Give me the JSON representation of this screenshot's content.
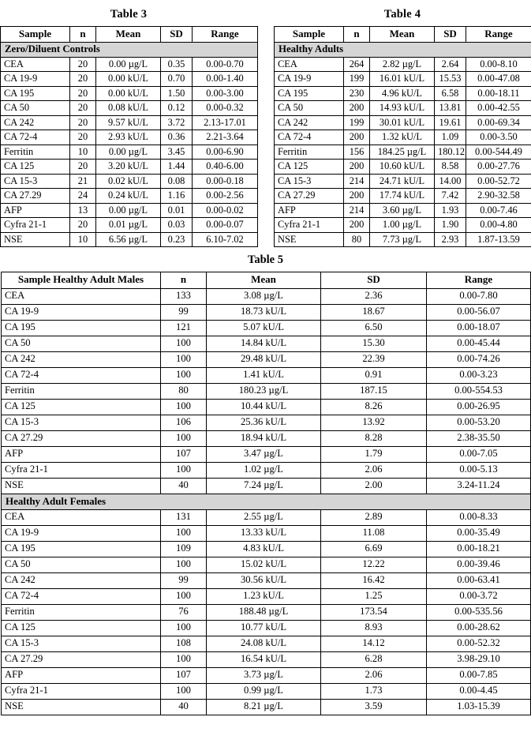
{
  "document": {
    "columns_header": [
      "Sample",
      "n",
      "Mean",
      "SD",
      "Range"
    ]
  },
  "table3": {
    "title": "Table 3",
    "headers": {
      "sample": "Sample",
      "n": "n",
      "mean": "Mean",
      "sd": "SD",
      "range": "Range"
    },
    "section_label": "Zero/Diluent Controls",
    "rows": [
      {
        "sample": "CEA",
        "n": "20",
        "mean": "0.00 µg/L",
        "sd": "0.35",
        "range": "0.00-0.70"
      },
      {
        "sample": "CA 19-9",
        "n": "20",
        "mean": "0.00 kU/L",
        "sd": "0.70",
        "range": "0.00-1.40"
      },
      {
        "sample": "CA 195",
        "n": "20",
        "mean": "0.00 kU/L",
        "sd": "1.50",
        "range": "0.00-3.00"
      },
      {
        "sample": "CA 50",
        "n": "20",
        "mean": "0.08 kU/L",
        "sd": "0.12",
        "range": "0.00-0.32"
      },
      {
        "sample": "CA 242",
        "n": "20",
        "mean": "9.57 kU/L",
        "sd": "3.72",
        "range": "2.13-17.01"
      },
      {
        "sample": "CA 72-4",
        "n": "20",
        "mean": "2.93 kU/L",
        "sd": "0.36",
        "range": "2.21-3.64"
      },
      {
        "sample": "Ferritin",
        "n": "10",
        "mean": "0.00 µg/L",
        "sd": "3.45",
        "range": "0.00-6.90"
      },
      {
        "sample": "CA 125",
        "n": "20",
        "mean": "3.20 kU/L",
        "sd": "1.44",
        "range": "0.40-6.00"
      },
      {
        "sample": "CA 15-3",
        "n": "21",
        "mean": "0.02 kU/L",
        "sd": "0.08",
        "range": "0.00-0.18"
      },
      {
        "sample": "CA 27.29",
        "n": "24",
        "mean": "0.24 kU/L",
        "sd": "1.16",
        "range": "0.00-2.56"
      },
      {
        "sample": "AFP",
        "n": "13",
        "mean": "0.00 µg/L",
        "sd": "0.01",
        "range": "0.00-0.02"
      },
      {
        "sample": "Cyfra 21-1",
        "n": "20",
        "mean": "0.01 µg/L",
        "sd": "0.03",
        "range": "0.00-0.07"
      },
      {
        "sample": "NSE",
        "n": "10",
        "mean": "6.56 µg/L",
        "sd": "0.23",
        "range": "6.10-7.02"
      }
    ]
  },
  "table4": {
    "title": "Table 4",
    "headers": {
      "sample": "Sample",
      "n": "n",
      "mean": "Mean",
      "sd": "SD",
      "range": "Range"
    },
    "section_label": "Healthy Adults",
    "rows": [
      {
        "sample": "CEA",
        "n": "264",
        "mean": "2.82 µg/L",
        "sd": "2.64",
        "range": "0.00-8.10"
      },
      {
        "sample": "CA 19-9",
        "n": "199",
        "mean": "16.01 kU/L",
        "sd": "15.53",
        "range": "0.00-47.08"
      },
      {
        "sample": "CA 195",
        "n": "230",
        "mean": "4.96 kU/L",
        "sd": "6.58",
        "range": "0.00-18.11"
      },
      {
        "sample": "CA 50",
        "n": "200",
        "mean": "14.93 kU/L",
        "sd": "13.81",
        "range": "0.00-42.55"
      },
      {
        "sample": "CA 242",
        "n": "199",
        "mean": "30.01 kU/L",
        "sd": "19.61",
        "range": "0.00-69.34"
      },
      {
        "sample": "CA 72-4",
        "n": "200",
        "mean": "1.32 kU/L",
        "sd": "1.09",
        "range": "0.00-3.50"
      },
      {
        "sample": "Ferritin",
        "n": "156",
        "mean": "184.25 µg/L",
        "sd": "180.12",
        "range": "0.00-544.49"
      },
      {
        "sample": "CA 125",
        "n": "200",
        "mean": "10.60 kU/L",
        "sd": "8.58",
        "range": "0.00-27.76"
      },
      {
        "sample": "CA 15-3",
        "n": "214",
        "mean": "24.71 kU/L",
        "sd": "14.00",
        "range": "0.00-52.72"
      },
      {
        "sample": "CA 27.29",
        "n": "200",
        "mean": "17.74 kU/L",
        "sd": "7.42",
        "range": "2.90-32.58"
      },
      {
        "sample": "AFP",
        "n": "214",
        "mean": "3.60 µg/L",
        "sd": "1.93",
        "range": "0.00-7.46"
      },
      {
        "sample": "Cyfra 21-1",
        "n": "200",
        "mean": "1.00 µg/L",
        "sd": "1.90",
        "range": "0.00-4.80"
      },
      {
        "sample": "NSE",
        "n": "80",
        "mean": "7.73 µg/L",
        "sd": "2.93",
        "range": "1.87-13.59"
      }
    ]
  },
  "table5": {
    "title": "Table 5",
    "headers": {
      "sample": "Sample Healthy Adult Males",
      "n": "n",
      "mean": "Mean",
      "sd": "SD",
      "range": "Range"
    },
    "males": [
      {
        "sample": "CEA",
        "n": "133",
        "mean": "3.08 µg/L",
        "sd": "2.36",
        "range": "0.00-7.80"
      },
      {
        "sample": "CA 19-9",
        "n": "99",
        "mean": "18.73 kU/L",
        "sd": "18.67",
        "range": "0.00-56.07"
      },
      {
        "sample": "CA 195",
        "n": "121",
        "mean": "5.07 kU/L",
        "sd": "6.50",
        "range": "0.00-18.07"
      },
      {
        "sample": "CA 50",
        "n": "100",
        "mean": "14.84 kU/L",
        "sd": "15.30",
        "range": "0.00-45.44"
      },
      {
        "sample": "CA 242",
        "n": "100",
        "mean": "29.48 kU/L",
        "sd": "22.39",
        "range": "0.00-74.26"
      },
      {
        "sample": "CA 72-4",
        "n": "100",
        "mean": "1.41 kU/L",
        "sd": "0.91",
        "range": "0.00-3.23"
      },
      {
        "sample": "Ferritin",
        "n": "80",
        "mean": "180.23 µg/L",
        "sd": "187.15",
        "range": "0.00-554.53"
      },
      {
        "sample": "CA 125",
        "n": "100",
        "mean": "10.44 kU/L",
        "sd": "8.26",
        "range": "0.00-26.95"
      },
      {
        "sample": "CA 15-3",
        "n": "106",
        "mean": "25.36 kU/L",
        "sd": "13.92",
        "range": "0.00-53.20"
      },
      {
        "sample": "CA 27.29",
        "n": "100",
        "mean": "18.94 kU/L",
        "sd": "8.28",
        "range": "2.38-35.50"
      },
      {
        "sample": "AFP",
        "n": "107",
        "mean": "3.47 µg/L",
        "sd": "1.79",
        "range": "0.00-7.05"
      },
      {
        "sample": "Cyfra 21-1",
        "n": "100",
        "mean": "1.02 µg/L",
        "sd": "2.06",
        "range": "0.00-5.13"
      },
      {
        "sample": "NSE",
        "n": "40",
        "mean": "7.24 µg/L",
        "sd": "2.00",
        "range": "3.24-11.24"
      }
    ],
    "females_section_label": "Healthy Adult Females",
    "females": [
      {
        "sample": "CEA",
        "n": "131",
        "mean": "2.55 µg/L",
        "sd": "2.89",
        "range": "0.00-8.33"
      },
      {
        "sample": "CA 19-9",
        "n": "100",
        "mean": "13.33 kU/L",
        "sd": "11.08",
        "range": "0.00-35.49"
      },
      {
        "sample": "CA 195",
        "n": "109",
        "mean": "4.83 kU/L",
        "sd": "6.69",
        "range": "0.00-18.21"
      },
      {
        "sample": "CA 50",
        "n": "100",
        "mean": "15.02 kU/L",
        "sd": "12.22",
        "range": "0.00-39.46"
      },
      {
        "sample": "CA 242",
        "n": "99",
        "mean": "30.56 kU/L",
        "sd": "16.42",
        "range": "0.00-63.41"
      },
      {
        "sample": "CA 72-4",
        "n": "100",
        "mean": "1.23 kU/L",
        "sd": "1.25",
        "range": "0.00-3.72"
      },
      {
        "sample": "Ferritin",
        "n": "76",
        "mean": "188.48 µg/L",
        "sd": "173.54",
        "range": "0.00-535.56"
      },
      {
        "sample": "CA 125",
        "n": "100",
        "mean": "10.77 kU/L",
        "sd": "8.93",
        "range": "0.00-28.62"
      },
      {
        "sample": "CA 15-3",
        "n": "108",
        "mean": "24.08 kU/L",
        "sd": "14.12",
        "range": "0.00-52.32"
      },
      {
        "sample": "CA 27.29",
        "n": "100",
        "mean": "16.54 kU/L",
        "sd": "6.28",
        "range": "3.98-29.10"
      },
      {
        "sample": "AFP",
        "n": "107",
        "mean": "3.73 µg/L",
        "sd": "2.06",
        "range": "0.00-7.85"
      },
      {
        "sample": "Cyfra 21-1",
        "n": "100",
        "mean": "0.99 µg/L",
        "sd": "1.73",
        "range": "0.00-4.45"
      },
      {
        "sample": "NSE",
        "n": "40",
        "mean": "8.21 µg/L",
        "sd": "3.59",
        "range": "1.03-15.39"
      }
    ]
  },
  "colors": {
    "section_band": "#d5d5d5",
    "border": "#000000",
    "text": "#000000",
    "background": "#ffffff"
  }
}
